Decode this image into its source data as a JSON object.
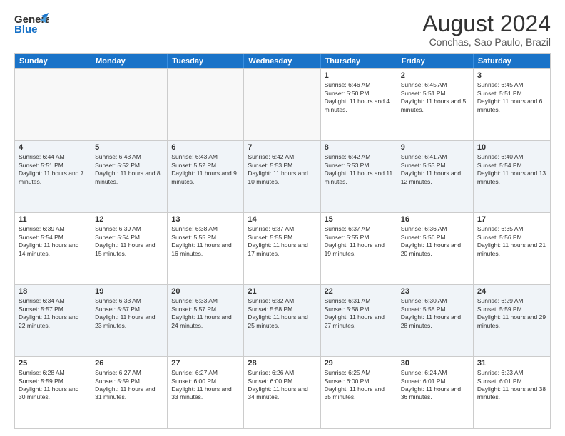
{
  "header": {
    "logo_line1": "General",
    "logo_line2": "Blue",
    "month_title": "August 2024",
    "location": "Conchas, Sao Paulo, Brazil"
  },
  "days_of_week": [
    "Sunday",
    "Monday",
    "Tuesday",
    "Wednesday",
    "Thursday",
    "Friday",
    "Saturday"
  ],
  "weeks": [
    [
      {
        "day": "",
        "sunrise": "",
        "sunset": "",
        "daylight": "",
        "empty": true
      },
      {
        "day": "",
        "sunrise": "",
        "sunset": "",
        "daylight": "",
        "empty": true
      },
      {
        "day": "",
        "sunrise": "",
        "sunset": "",
        "daylight": "",
        "empty": true
      },
      {
        "day": "",
        "sunrise": "",
        "sunset": "",
        "daylight": "",
        "empty": true
      },
      {
        "day": "1",
        "sunrise": "Sunrise: 6:46 AM",
        "sunset": "Sunset: 5:50 PM",
        "daylight": "Daylight: 11 hours and 4 minutes."
      },
      {
        "day": "2",
        "sunrise": "Sunrise: 6:45 AM",
        "sunset": "Sunset: 5:51 PM",
        "daylight": "Daylight: 11 hours and 5 minutes."
      },
      {
        "day": "3",
        "sunrise": "Sunrise: 6:45 AM",
        "sunset": "Sunset: 5:51 PM",
        "daylight": "Daylight: 11 hours and 6 minutes."
      }
    ],
    [
      {
        "day": "4",
        "sunrise": "Sunrise: 6:44 AM",
        "sunset": "Sunset: 5:51 PM",
        "daylight": "Daylight: 11 hours and 7 minutes."
      },
      {
        "day": "5",
        "sunrise": "Sunrise: 6:43 AM",
        "sunset": "Sunset: 5:52 PM",
        "daylight": "Daylight: 11 hours and 8 minutes."
      },
      {
        "day": "6",
        "sunrise": "Sunrise: 6:43 AM",
        "sunset": "Sunset: 5:52 PM",
        "daylight": "Daylight: 11 hours and 9 minutes."
      },
      {
        "day": "7",
        "sunrise": "Sunrise: 6:42 AM",
        "sunset": "Sunset: 5:53 PM",
        "daylight": "Daylight: 11 hours and 10 minutes."
      },
      {
        "day": "8",
        "sunrise": "Sunrise: 6:42 AM",
        "sunset": "Sunset: 5:53 PM",
        "daylight": "Daylight: 11 hours and 11 minutes."
      },
      {
        "day": "9",
        "sunrise": "Sunrise: 6:41 AM",
        "sunset": "Sunset: 5:53 PM",
        "daylight": "Daylight: 11 hours and 12 minutes."
      },
      {
        "day": "10",
        "sunrise": "Sunrise: 6:40 AM",
        "sunset": "Sunset: 5:54 PM",
        "daylight": "Daylight: 11 hours and 13 minutes."
      }
    ],
    [
      {
        "day": "11",
        "sunrise": "Sunrise: 6:39 AM",
        "sunset": "Sunset: 5:54 PM",
        "daylight": "Daylight: 11 hours and 14 minutes."
      },
      {
        "day": "12",
        "sunrise": "Sunrise: 6:39 AM",
        "sunset": "Sunset: 5:54 PM",
        "daylight": "Daylight: 11 hours and 15 minutes."
      },
      {
        "day": "13",
        "sunrise": "Sunrise: 6:38 AM",
        "sunset": "Sunset: 5:55 PM",
        "daylight": "Daylight: 11 hours and 16 minutes."
      },
      {
        "day": "14",
        "sunrise": "Sunrise: 6:37 AM",
        "sunset": "Sunset: 5:55 PM",
        "daylight": "Daylight: 11 hours and 17 minutes."
      },
      {
        "day": "15",
        "sunrise": "Sunrise: 6:37 AM",
        "sunset": "Sunset: 5:55 PM",
        "daylight": "Daylight: 11 hours and 19 minutes."
      },
      {
        "day": "16",
        "sunrise": "Sunrise: 6:36 AM",
        "sunset": "Sunset: 5:56 PM",
        "daylight": "Daylight: 11 hours and 20 minutes."
      },
      {
        "day": "17",
        "sunrise": "Sunrise: 6:35 AM",
        "sunset": "Sunset: 5:56 PM",
        "daylight": "Daylight: 11 hours and 21 minutes."
      }
    ],
    [
      {
        "day": "18",
        "sunrise": "Sunrise: 6:34 AM",
        "sunset": "Sunset: 5:57 PM",
        "daylight": "Daylight: 11 hours and 22 minutes."
      },
      {
        "day": "19",
        "sunrise": "Sunrise: 6:33 AM",
        "sunset": "Sunset: 5:57 PM",
        "daylight": "Daylight: 11 hours and 23 minutes."
      },
      {
        "day": "20",
        "sunrise": "Sunrise: 6:33 AM",
        "sunset": "Sunset: 5:57 PM",
        "daylight": "Daylight: 11 hours and 24 minutes."
      },
      {
        "day": "21",
        "sunrise": "Sunrise: 6:32 AM",
        "sunset": "Sunset: 5:58 PM",
        "daylight": "Daylight: 11 hours and 25 minutes."
      },
      {
        "day": "22",
        "sunrise": "Sunrise: 6:31 AM",
        "sunset": "Sunset: 5:58 PM",
        "daylight": "Daylight: 11 hours and 27 minutes."
      },
      {
        "day": "23",
        "sunrise": "Sunrise: 6:30 AM",
        "sunset": "Sunset: 5:58 PM",
        "daylight": "Daylight: 11 hours and 28 minutes."
      },
      {
        "day": "24",
        "sunrise": "Sunrise: 6:29 AM",
        "sunset": "Sunset: 5:59 PM",
        "daylight": "Daylight: 11 hours and 29 minutes."
      }
    ],
    [
      {
        "day": "25",
        "sunrise": "Sunrise: 6:28 AM",
        "sunset": "Sunset: 5:59 PM",
        "daylight": "Daylight: 11 hours and 30 minutes."
      },
      {
        "day": "26",
        "sunrise": "Sunrise: 6:27 AM",
        "sunset": "Sunset: 5:59 PM",
        "daylight": "Daylight: 11 hours and 31 minutes."
      },
      {
        "day": "27",
        "sunrise": "Sunrise: 6:27 AM",
        "sunset": "Sunset: 6:00 PM",
        "daylight": "Daylight: 11 hours and 33 minutes."
      },
      {
        "day": "28",
        "sunrise": "Sunrise: 6:26 AM",
        "sunset": "Sunset: 6:00 PM",
        "daylight": "Daylight: 11 hours and 34 minutes."
      },
      {
        "day": "29",
        "sunrise": "Sunrise: 6:25 AM",
        "sunset": "Sunset: 6:00 PM",
        "daylight": "Daylight: 11 hours and 35 minutes."
      },
      {
        "day": "30",
        "sunrise": "Sunrise: 6:24 AM",
        "sunset": "Sunset: 6:01 PM",
        "daylight": "Daylight: 11 hours and 36 minutes."
      },
      {
        "day": "31",
        "sunrise": "Sunrise: 6:23 AM",
        "sunset": "Sunset: 6:01 PM",
        "daylight": "Daylight: 11 hours and 38 minutes."
      }
    ]
  ]
}
